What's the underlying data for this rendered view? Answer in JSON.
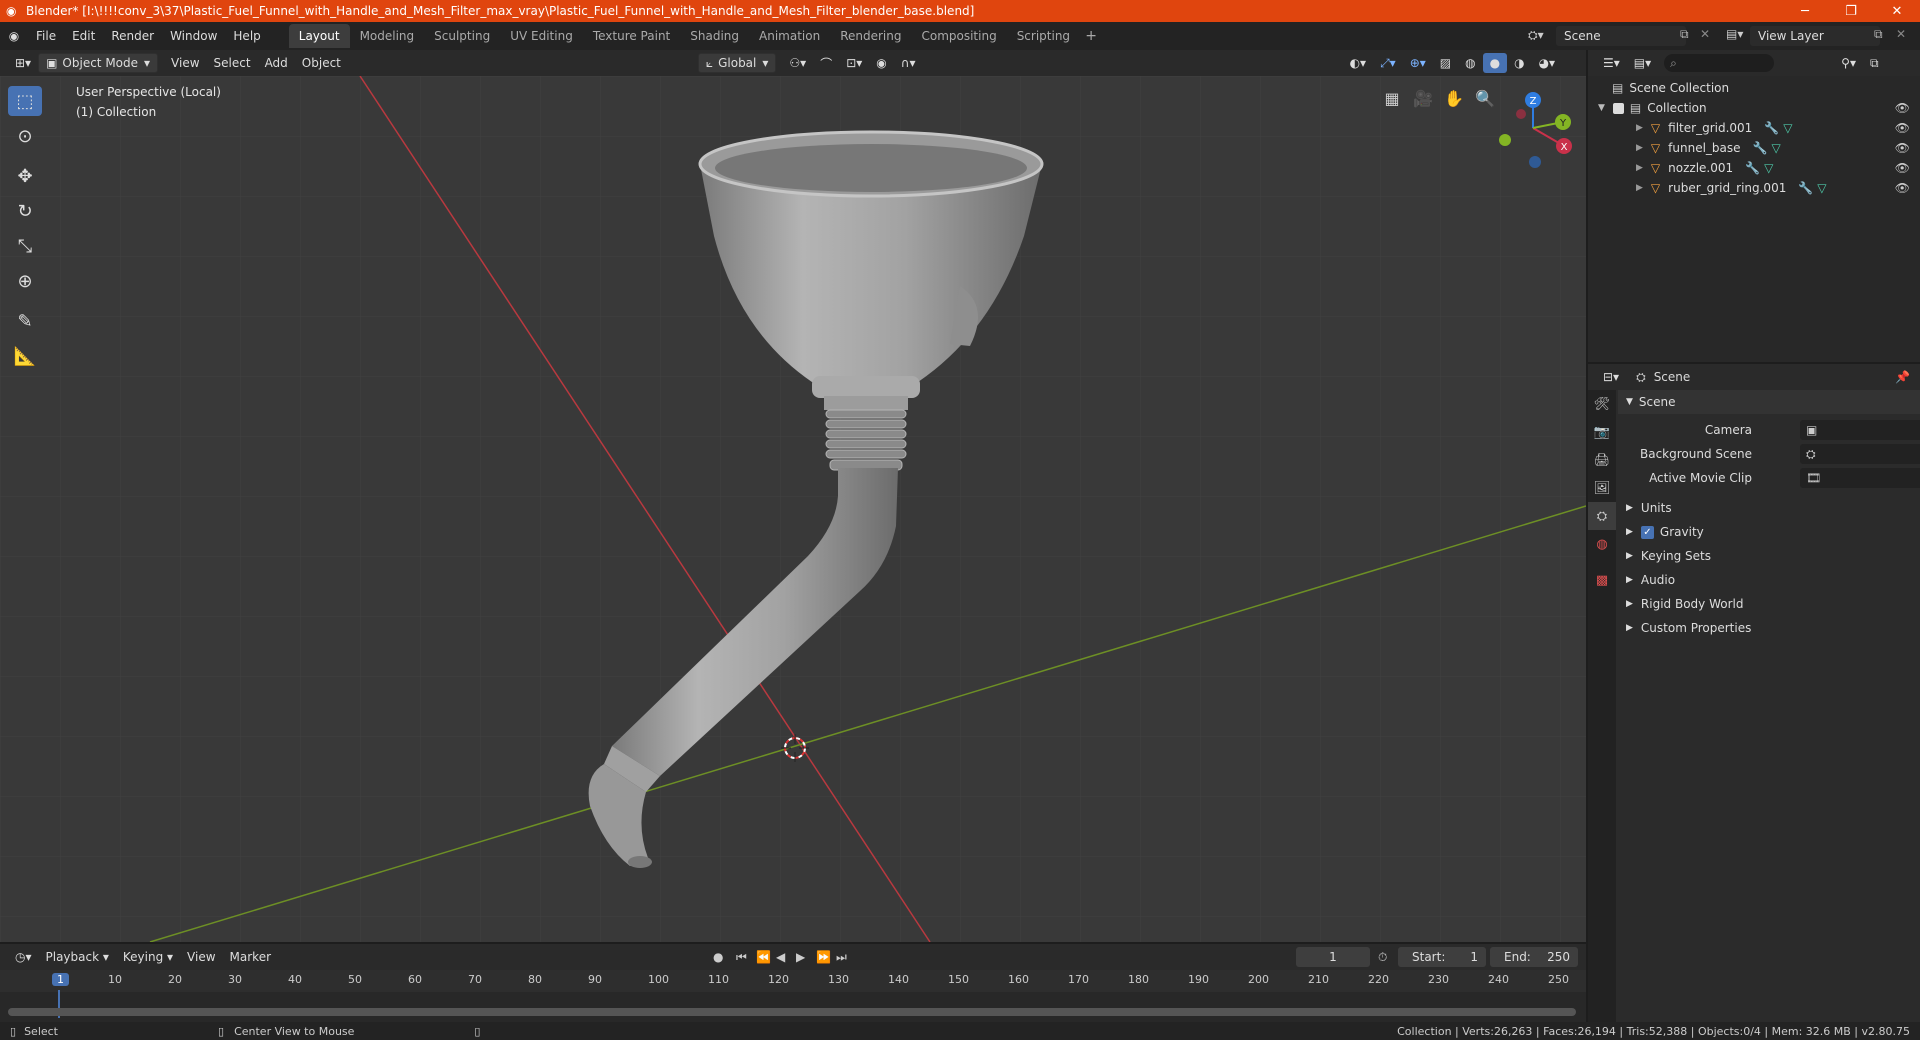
{
  "titlebar": {
    "title": "Blender* [I:\\!!!!conv_3\\37\\Plastic_Fuel_Funnel_with_Handle_and_Mesh_Filter_max_vray\\Plastic_Fuel_Funnel_with_Handle_and_Mesh_Filter_blender_base.blend]",
    "accent": "#e0450e"
  },
  "menubar": {
    "items": [
      "File",
      "Edit",
      "Render",
      "Window",
      "Help"
    ]
  },
  "workspaces": {
    "tabs": [
      "Layout",
      "Modeling",
      "Sculpting",
      "UV Editing",
      "Texture Paint",
      "Shading",
      "Animation",
      "Rendering",
      "Compositing",
      "Scripting"
    ],
    "active": "Layout"
  },
  "scene_selector": {
    "value": "Scene"
  },
  "viewlayer_selector": {
    "value": "View Layer"
  },
  "viewport_header": {
    "mode": "Object Mode",
    "menus": [
      "View",
      "Select",
      "Add",
      "Object"
    ],
    "transform_orientation": "Global"
  },
  "viewport": {
    "perspective_label": "User Perspective (Local)",
    "collection_label": "(1) Collection",
    "axis_x": "X",
    "axis_y": "Y",
    "axis_z": "Z",
    "colors": {
      "x_axis": "#c9314a",
      "y_axis": "#84b524",
      "z_axis": "#2f7de1"
    }
  },
  "outliner": {
    "root": "Scene Collection",
    "collection": "Collection",
    "objects": [
      "filter_grid.001",
      "funnel_base",
      "nozzle.001",
      "ruber_grid_ring.001"
    ]
  },
  "properties": {
    "header": "Scene",
    "panel_title": "Scene",
    "fields": [
      {
        "label": "Camera"
      },
      {
        "label": "Background Scene"
      },
      {
        "label": "Active Movie Clip"
      }
    ],
    "subpanels": [
      "Units",
      "Gravity",
      "Keying Sets",
      "Audio",
      "Rigid Body World",
      "Custom Properties"
    ]
  },
  "timeline": {
    "menus": [
      "Playback",
      "Keying",
      "View",
      "Marker"
    ],
    "current_frame": "1",
    "start_label": "Start:",
    "start": "1",
    "end_label": "End:",
    "end": "250",
    "ruler": [
      "1",
      "10",
      "20",
      "30",
      "40",
      "50",
      "60",
      "70",
      "80",
      "90",
      "100",
      "110",
      "120",
      "130",
      "140",
      "150",
      "160",
      "170",
      "180",
      "190",
      "200",
      "210",
      "220",
      "230",
      "240",
      "250"
    ]
  },
  "statusbar": {
    "left_action": "Select",
    "middle_action": "Center View to Mouse",
    "stats": "Collection | Verts:26,263 | Faces:26,194 | Tris:52,388 | Objects:0/4 | Mem: 32.6 MB | v2.80.75"
  }
}
